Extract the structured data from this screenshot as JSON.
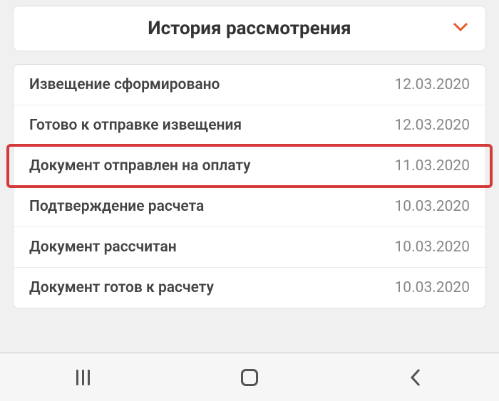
{
  "header": {
    "title": "История рассмотрения"
  },
  "history": [
    {
      "label": "Извещение сформировано",
      "date": "12.03.2020",
      "highlighted": false
    },
    {
      "label": "Готово к отправке извещения",
      "date": "12.03.2020",
      "highlighted": false
    },
    {
      "label": "Документ отправлен на оплату",
      "date": "11.03.2020",
      "highlighted": true
    },
    {
      "label": "Подтверждение расчета",
      "date": "10.03.2020",
      "highlighted": false
    },
    {
      "label": "Документ рассчитан",
      "date": "10.03.2020",
      "highlighted": false
    },
    {
      "label": "Документ готов к расчету",
      "date": "10.03.2020",
      "highlighted": false
    }
  ],
  "colors": {
    "accent": "#e85a2c",
    "highlight": "#d43a3a"
  }
}
